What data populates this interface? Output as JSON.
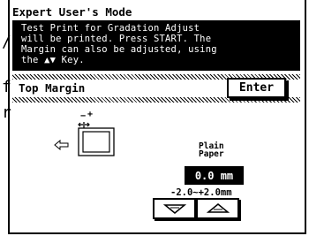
{
  "window": {
    "title": "Expert User's Mode"
  },
  "message": {
    "lines": [
      "Test Print for Gradation Adjust",
      "will be printed. Press START. The",
      "Margin can also be adjusted, using",
      "the ▲▼ Key."
    ]
  },
  "section": {
    "title": "Top Margin",
    "enter_label": "Enter"
  },
  "diagram": {
    "minus_sign": "−",
    "plus_sign": "+"
  },
  "paper": {
    "line1": "Plain",
    "line2": "Paper"
  },
  "margin": {
    "value": "0.0 mm",
    "range": "-2.0~+2.0mm"
  },
  "side_text": [
    "/",
    "f",
    "r"
  ],
  "icons": {
    "left_arrow": "left-arrow-icon",
    "down": "down-triangle-icon",
    "up": "up-triangle-icon"
  }
}
